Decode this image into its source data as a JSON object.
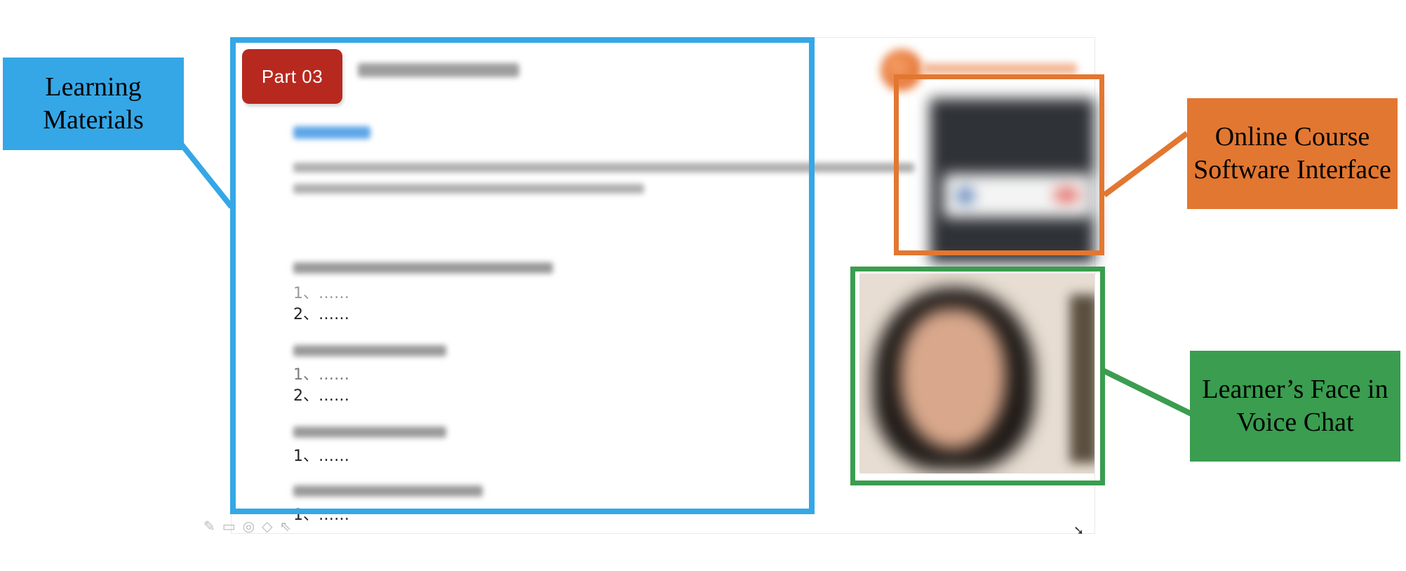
{
  "callouts": {
    "learning_materials": "Learning Materials",
    "online_course": "Online Course Software Interface",
    "learners_face": "Learner’s Face in Voice Chat"
  },
  "badge": {
    "label": "Part 03"
  },
  "list_items": {
    "a1": "1、……",
    "a2": "2、……",
    "b1": "1、……",
    "b2": "2、……",
    "c1": "1、……",
    "d1": "1、……"
  },
  "colors": {
    "learning_materials": "#35a7e6",
    "online_course": "#e27731",
    "learners_face": "#3a9d4f",
    "badge": "#b7291f"
  },
  "icons": {
    "toolbar": [
      "pencil-icon",
      "whiteboard-icon",
      "eye-icon",
      "eraser-icon",
      "pointer-icon"
    ],
    "cursor": "mouse-cursor-icon"
  }
}
